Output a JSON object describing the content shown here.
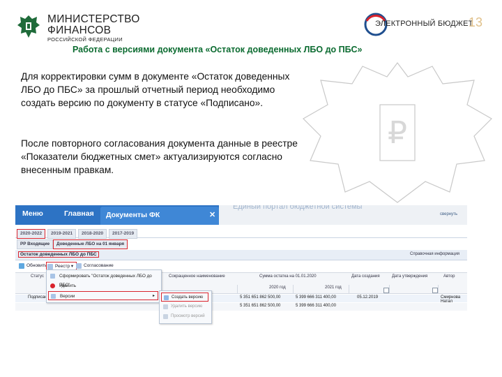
{
  "header": {
    "ministry_line1": "МИНИСТЕРСТВО",
    "ministry_line2": "ФИНАНСОВ",
    "ministry_line3": "РОССИЙСКОЙ ФЕДЕРАЦИИ",
    "budget_logo_text": "ЭЛЕКТРОННЫЙ  БЮДЖЕТ",
    "page_number": "13"
  },
  "slide": {
    "title": "Работа с версиями документа «Остаток доведенных ЛБО до ПБС»",
    "paragraph1": "Для корректировки сумм в документе «Остаток доведенных ЛБО до ПБС» за прошлый отчетный период необходимо создать версию по документу в статусе «Подписано».",
    "paragraph2": "После повторного согласования документа данные в реестре «Показатели бюджетных смет» актуализируются согласно внесенным правкам."
  },
  "app": {
    "nav_menu": "Меню",
    "nav_home": "Главная",
    "tab_docs": "Документы ФК",
    "tab_close": "✕",
    "portal_text": "Единый портал бюджетной системы",
    "collapse": "свернуть",
    "year_tabs": [
      "2020-2022",
      "2019-2021",
      "2018-2020",
      "2017-2019"
    ],
    "sub_tabs": [
      "РР Входящие",
      "Доведенные ЛБО на 01 января"
    ],
    "doc_title": "Остаток доведенных ЛБО до ПБС",
    "reference_info": "Справочная информация",
    "toolbar": {
      "refresh": "Обновить",
      "registry": "Реестр ▾",
      "approval": "Согласование"
    },
    "grid_headers": {
      "status": "Статус",
      "short_name": "Сокращенное наименование",
      "balance": "Сумма остатка на 01.01.2020",
      "created": "Дата создания",
      "approved": "Дата утверждения",
      "author": "Автор",
      "year1": "2020 год",
      "year2": "2021 год"
    },
    "rows": [
      {
        "status": "Подписано",
        "sum1": "5 351 651 862 500,00",
        "sum2": "5 399 666 311 400,00",
        "created": "05.12.2019",
        "author": "Смирнова Натал"
      },
      {
        "status": "",
        "sum1": "5 351 651 862 500,00",
        "sum2": "5 399 666 311 400,00",
        "created": "",
        "author": ""
      }
    ],
    "menu_items": [
      "Сформировать \"Остаток доведенных ЛБО до ПБС\"",
      "Удалить",
      "Версии"
    ],
    "submenu_items": [
      "Создать версию",
      "Удалить версию",
      "Просмотр версий"
    ]
  },
  "colors": {
    "title_green": "#0b6b30",
    "app_blue": "#2d73c4",
    "highlight_red": "#d9232d"
  }
}
